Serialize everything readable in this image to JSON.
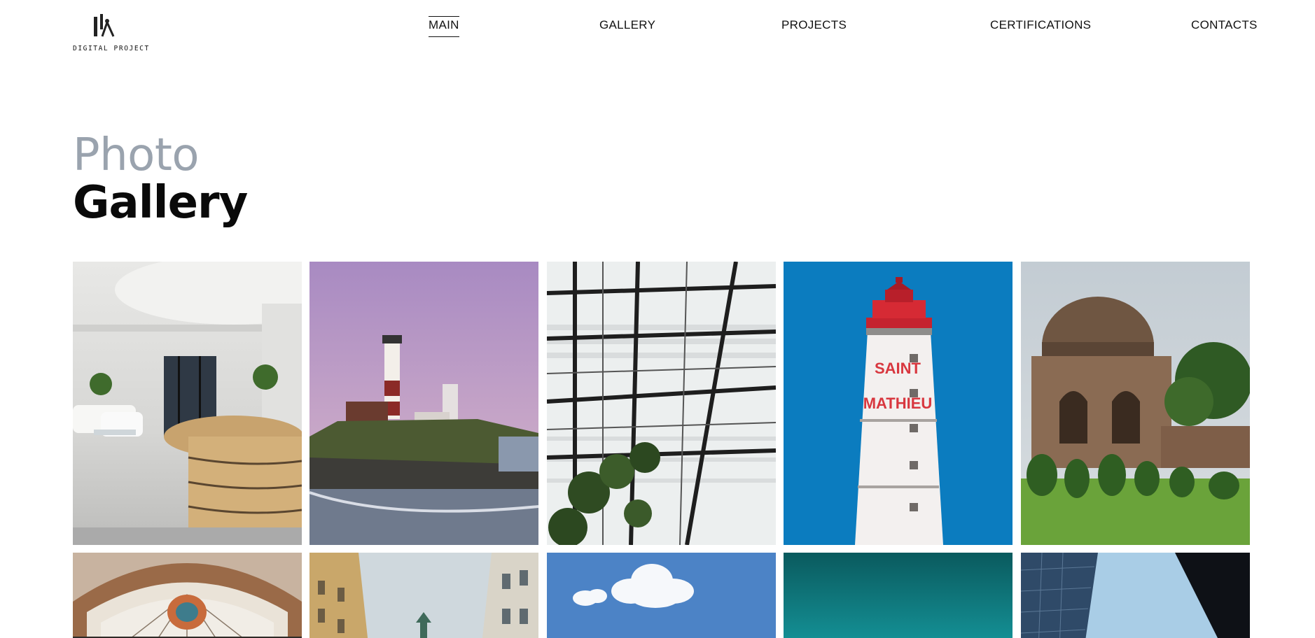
{
  "brand": {
    "logo_text": "DIGITAL PROJECT",
    "logo_icon": "compass-pencil-logo"
  },
  "nav": {
    "items": [
      {
        "label": "MAIN",
        "active": true
      },
      {
        "label": "GALLERY",
        "active": false
      },
      {
        "label": "PROJECTS",
        "active": false
      },
      {
        "label": "CERTIFICATIONS",
        "active": false
      },
      {
        "label": "CONTACTS",
        "active": false
      }
    ]
  },
  "hero": {
    "title_light": "Photo",
    "title_bold": "Gallery"
  },
  "colors": {
    "title_light": "#9aa3ae",
    "text": "#111111",
    "background": "#ffffff"
  },
  "gallery": {
    "photos": [
      {
        "subject": "office-lobby-reception"
      },
      {
        "subject": "lighthouse-on-cliff-dusk"
      },
      {
        "subject": "glass-greenhouse-roof"
      },
      {
        "subject": "red-white-lighthouse-blue-sky",
        "sign_text_1": "SAINT",
        "sign_text_2": "MATHIEU"
      },
      {
        "subject": "domed-mughal-tomb"
      },
      {
        "subject": "ornate-arched-window"
      },
      {
        "subject": "street-buildings-upward"
      },
      {
        "subject": "blue-sky-clouds"
      },
      {
        "subject": "teal-gradient-sky"
      },
      {
        "subject": "skyscraper-upward-view"
      }
    ]
  }
}
